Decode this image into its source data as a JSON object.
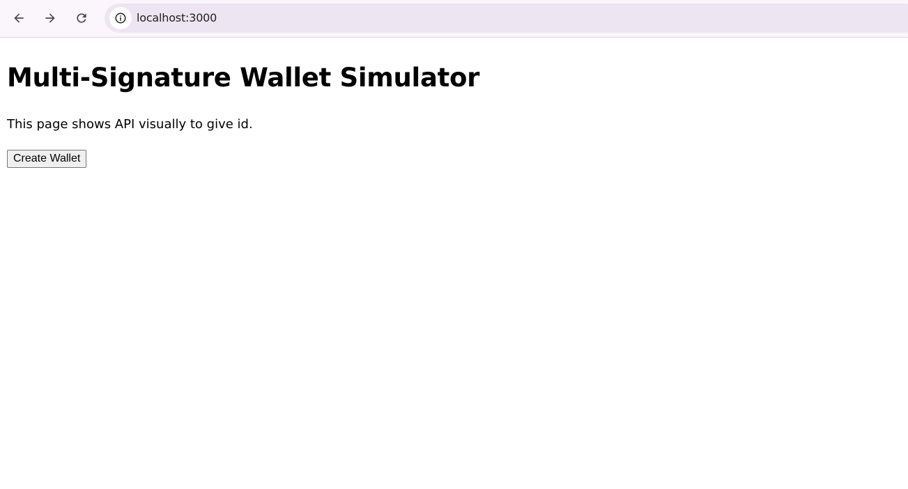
{
  "browser": {
    "url": "localhost:3000",
    "icons": {
      "back": "arrow-left-icon",
      "forward": "arrow-right-icon",
      "reload": "reload-icon",
      "site_info": "info-circle-icon"
    }
  },
  "page": {
    "title": "Multi-Signature Wallet Simulator",
    "description": "This page shows API visually to give id.",
    "create_wallet_label": "Create Wallet"
  }
}
